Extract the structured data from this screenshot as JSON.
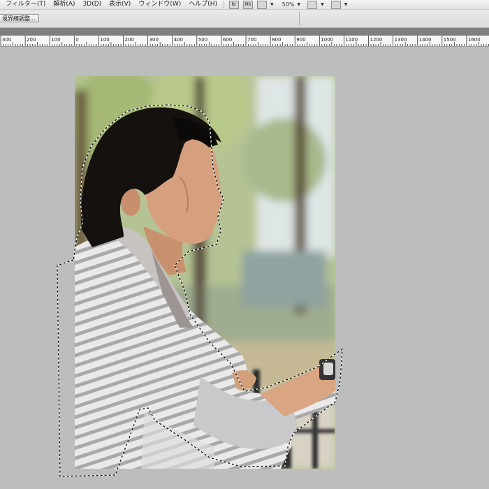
{
  "menubar": {
    "items": [
      "フィルター(T)",
      "解析(A)",
      "3D(D)",
      "表示(V)",
      "ウィンドウ(W)",
      "ヘルプ(H)"
    ],
    "icon_br": "Br",
    "icon_mb": "Mb",
    "zoom": "50%"
  },
  "optbar": {
    "refine_edge": "境界線調整..."
  },
  "ruler": {
    "labels": [
      "300",
      "200",
      "100",
      "0",
      "100",
      "200",
      "300",
      "400",
      "500",
      "600",
      "700",
      "800",
      "900",
      "1000",
      "1100",
      "1200",
      "1300",
      "1400",
      "1500",
      "1600"
    ]
  },
  "colors": {
    "chrome": "#e4e4e4",
    "canvas": "#bdbdbd",
    "selection": "#000000"
  }
}
